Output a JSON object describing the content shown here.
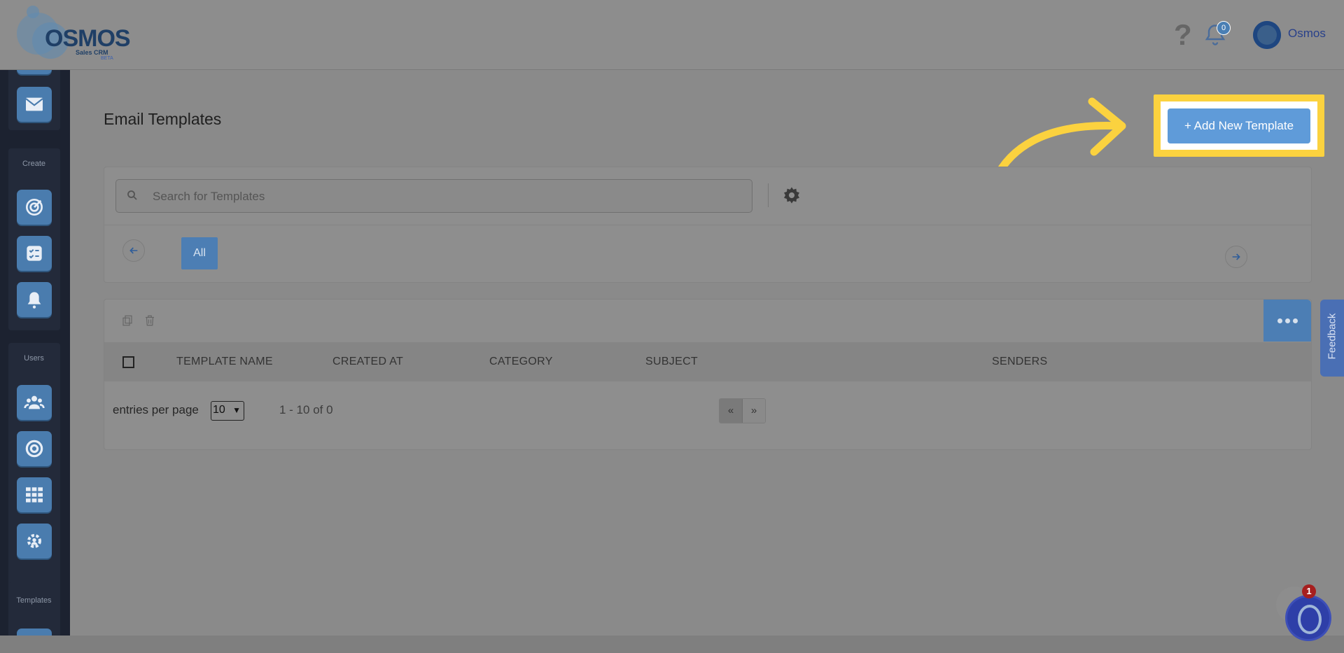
{
  "header": {
    "logo_word": "OSMOS",
    "logo_sub": "Sales CRM",
    "logo_beta": "BETA",
    "help_glyph": "?",
    "notifications_count": "0",
    "user_name": "Osmos",
    "icons": [
      "help-icon",
      "bell-icon",
      "avatar"
    ]
  },
  "sidebar": {
    "sections": [
      {
        "label": "Create",
        "items": [
          "target-icon",
          "checklist-icon",
          "alarm-bell-icon"
        ]
      },
      {
        "label": "Users",
        "items": [
          "users-icon",
          "circle-target-icon",
          "grid-icon",
          "gear-people-icon"
        ]
      },
      {
        "label": "Templates",
        "items": []
      }
    ],
    "top_item_icon": "mail-icon"
  },
  "page": {
    "title": "Email Templates",
    "add_button_label": "+ Add New Template"
  },
  "filters": {
    "search_placeholder": "Search for Templates",
    "chip_all": "All"
  },
  "table": {
    "columns": [
      "TEMPLATE NAME",
      "CREATED AT",
      "CATEGORY",
      "SUBJECT",
      "SENDERS"
    ],
    "rows": [],
    "entries_label": "entries per page",
    "per_page_value": "10",
    "range_text": "1 - 10 of 0",
    "pager_prev": "«",
    "pager_next": "»"
  },
  "widgets": {
    "feedback_label": "Feedback",
    "chat_badge": "1"
  },
  "colors": {
    "accent": "#5f9bd9",
    "highlight": "#fbd23f",
    "sidebar_bg": "#1c2230"
  }
}
